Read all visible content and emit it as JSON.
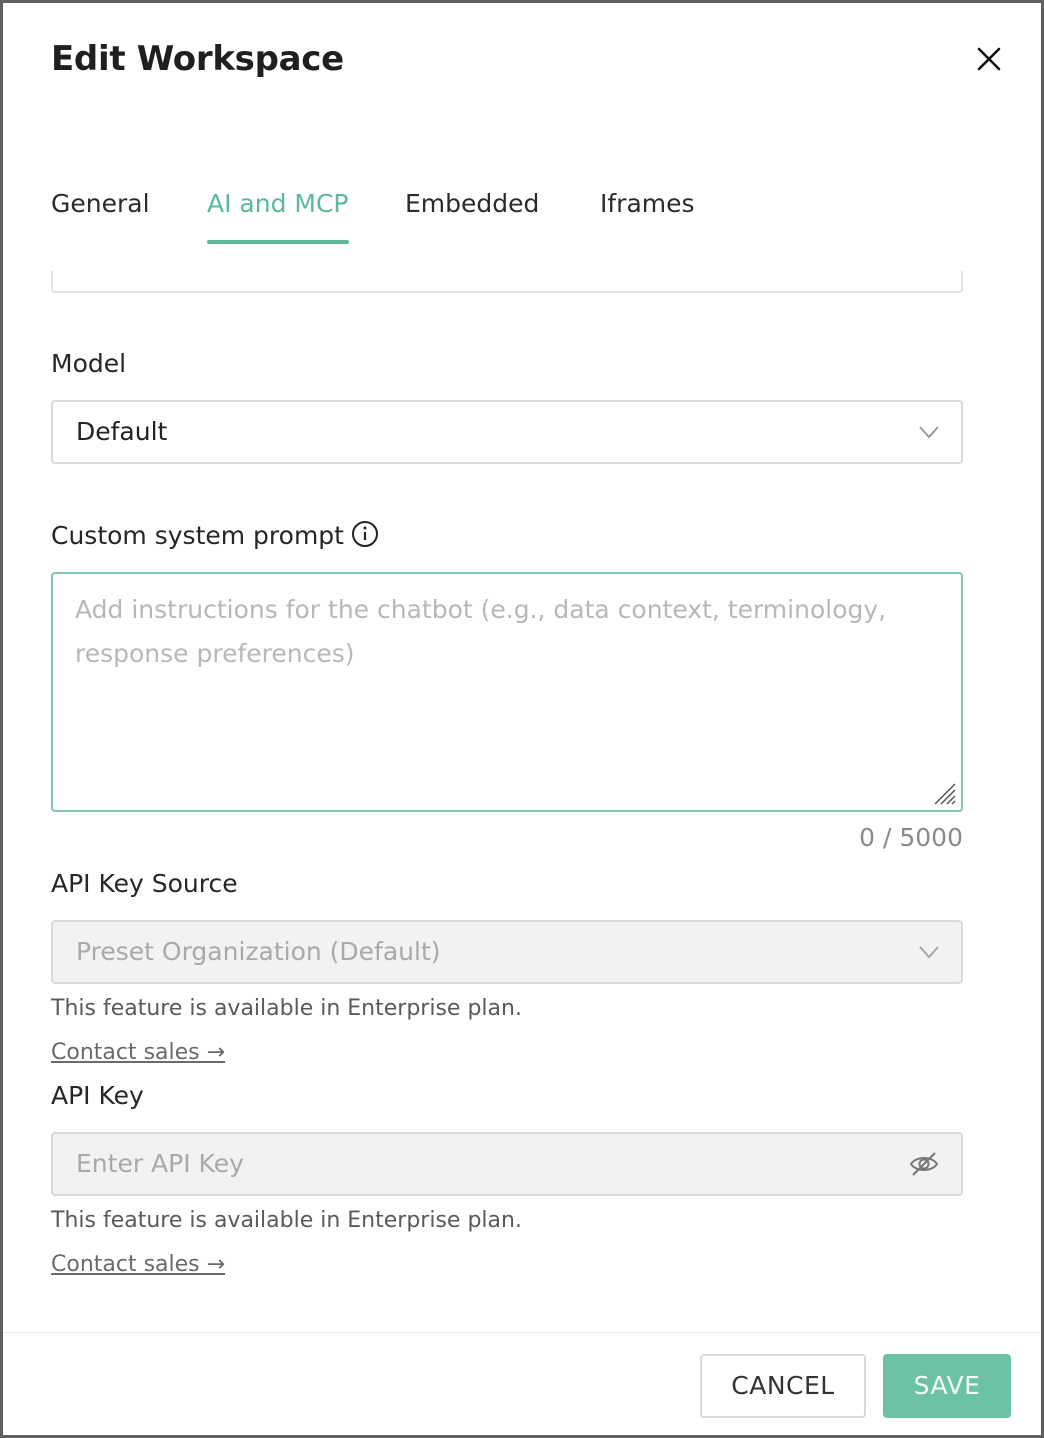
{
  "dialog": {
    "title": "Edit Workspace"
  },
  "tabs": [
    {
      "label": "General",
      "active": false
    },
    {
      "label": "AI and MCP",
      "active": true
    },
    {
      "label": "Embedded",
      "active": false
    },
    {
      "label": "Iframes",
      "active": false
    }
  ],
  "model": {
    "label": "Model",
    "value": "Default"
  },
  "system_prompt": {
    "label": "Custom system prompt",
    "placeholder": "Add instructions for the chatbot (e.g., data context, terminology, response preferences)",
    "value": "",
    "counter": "0 / 5000"
  },
  "api_key_source": {
    "label": "API Key Source",
    "value": "Preset Organization (Default)",
    "note": "This feature is available in Enterprise plan.",
    "link": "Contact sales →"
  },
  "api_key": {
    "label": "API Key",
    "placeholder": "Enter API Key",
    "note": "This feature is available in Enterprise plan.",
    "link": "Contact sales →"
  },
  "footer": {
    "cancel_label": "CANCEL",
    "save_label": "SAVE"
  },
  "colors": {
    "accent": "#5cb99a",
    "save_button": "#6cc3a4",
    "focus_border": "#7cc9ad"
  },
  "icons": {
    "close": "close-icon",
    "info": "info-icon",
    "dropdown": "chevron-down-icon",
    "visibility": "eye-off-icon",
    "resize": "resize-handle-icon"
  }
}
